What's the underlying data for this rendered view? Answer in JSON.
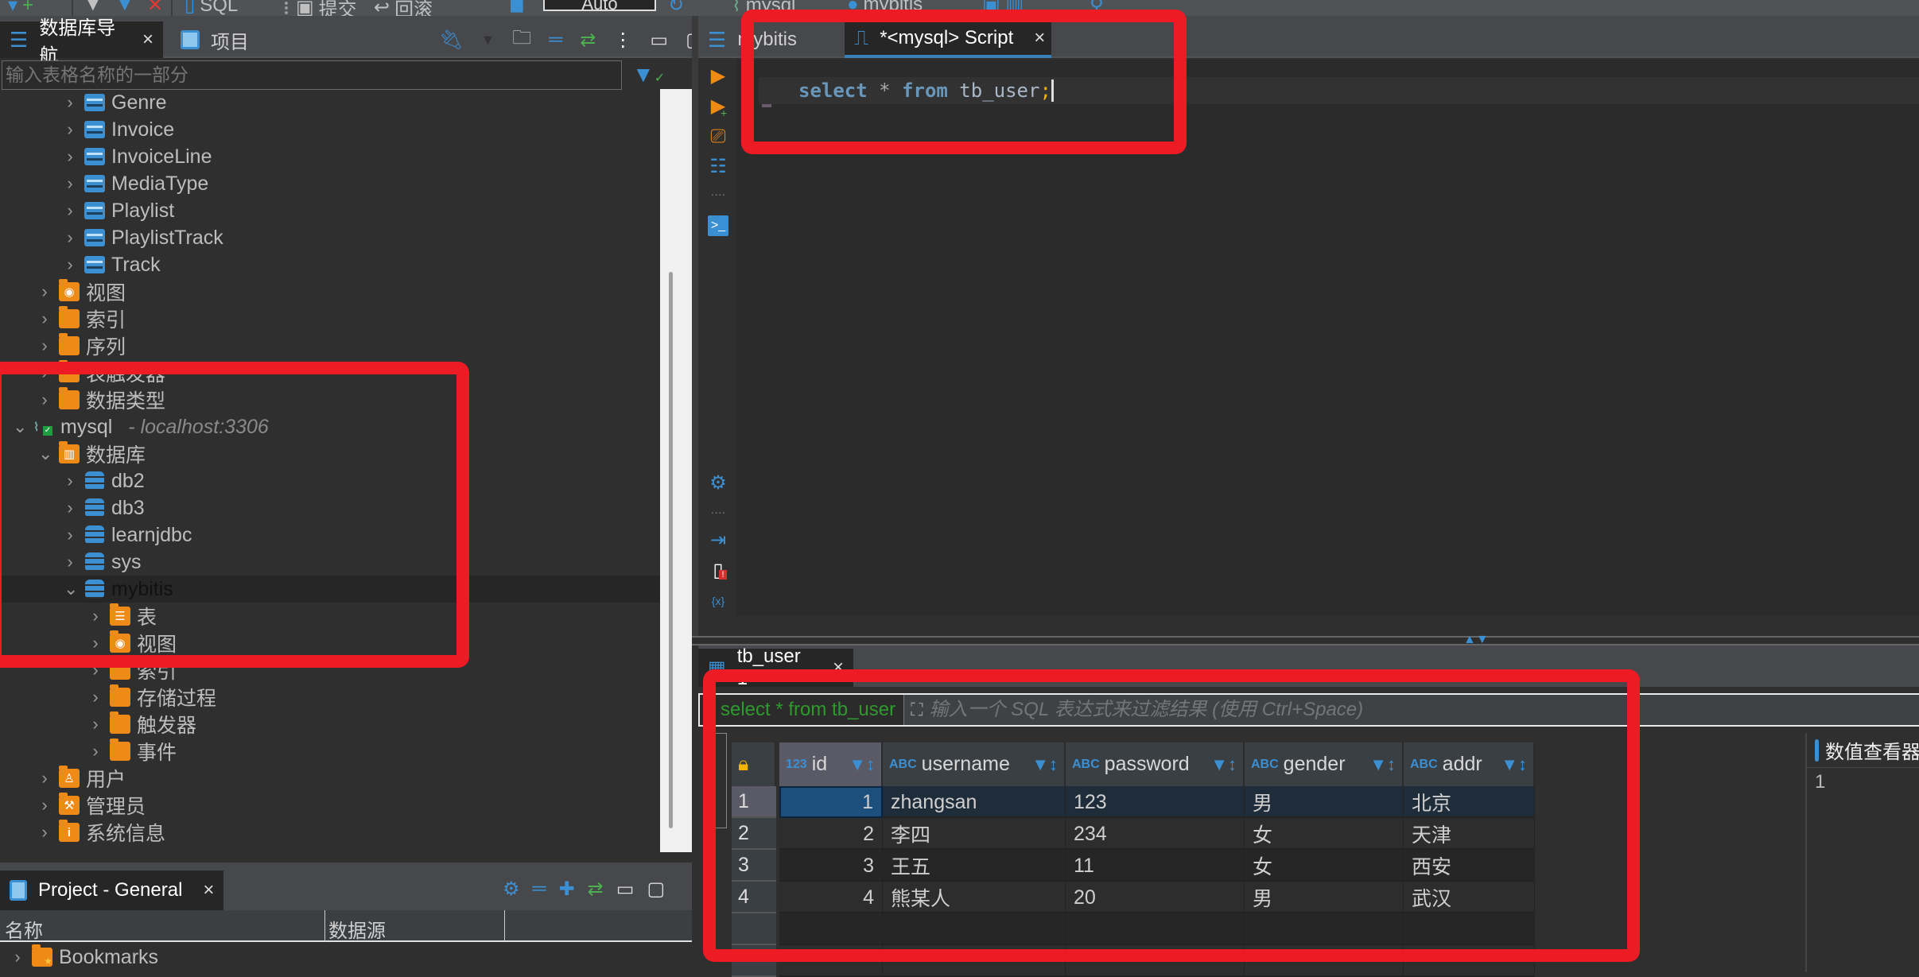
{
  "toolbar": {
    "sql_label": "SQL",
    "commit_label": "提交",
    "rollback_label": "回滚",
    "tx_mode": "Auto",
    "connection": "mysql",
    "database": "mybitis"
  },
  "nav": {
    "tabs": [
      {
        "label": "数据库导航",
        "active": true
      },
      {
        "label": "项目",
        "active": false
      }
    ],
    "filter_placeholder": "输入表格名称的一部分",
    "tree": [
      {
        "label": "Genre",
        "icon": "table-icon",
        "indent": 2
      },
      {
        "label": "Invoice",
        "icon": "table-icon",
        "indent": 2
      },
      {
        "label": "InvoiceLine",
        "icon": "table-icon",
        "indent": 2
      },
      {
        "label": "MediaType",
        "icon": "table-icon",
        "indent": 2
      },
      {
        "label": "Playlist",
        "icon": "table-icon",
        "indent": 2
      },
      {
        "label": "PlaylistTrack",
        "icon": "table-icon",
        "indent": 2
      },
      {
        "label": "Track",
        "icon": "table-icon",
        "indent": 2
      },
      {
        "label": "视图",
        "icon": "view-folder-icon",
        "indent": 1
      },
      {
        "label": "索引",
        "icon": "folder-icon",
        "indent": 1
      },
      {
        "label": "序列",
        "icon": "folder-icon",
        "indent": 1
      },
      {
        "label": "表触发器",
        "icon": "folder-icon",
        "indent": 1
      },
      {
        "label": "数据类型",
        "icon": "folder-icon",
        "indent": 1
      },
      {
        "label": "mysql",
        "sublabel": "- localhost:3306",
        "icon": "mysql-icon",
        "indent": 0,
        "expanded": true
      },
      {
        "label": "数据库",
        "icon": "databases-folder-icon",
        "indent": 1,
        "expanded": true
      },
      {
        "label": "db2",
        "icon": "database-icon",
        "indent": 2
      },
      {
        "label": "db3",
        "icon": "database-icon",
        "indent": 2
      },
      {
        "label": "learnjdbc",
        "icon": "database-icon",
        "indent": 2
      },
      {
        "label": "sys",
        "icon": "database-icon",
        "indent": 2
      },
      {
        "label": "mybitis",
        "icon": "database-icon",
        "indent": 2,
        "expanded": true,
        "selected": true
      },
      {
        "label": "表",
        "icon": "tables-folder-icon",
        "indent": 3
      },
      {
        "label": "视图",
        "icon": "view-folder-icon",
        "indent": 3
      },
      {
        "label": "索引",
        "icon": "folder-icon",
        "indent": 3
      },
      {
        "label": "存储过程",
        "icon": "folder-icon",
        "indent": 3
      },
      {
        "label": "触发器",
        "icon": "folder-icon",
        "indent": 3
      },
      {
        "label": "事件",
        "icon": "folder-icon",
        "indent": 3
      },
      {
        "label": "用户",
        "icon": "users-folder-icon",
        "indent": 1
      },
      {
        "label": "管理员",
        "icon": "admin-folder-icon",
        "indent": 1
      },
      {
        "label": "系统信息",
        "icon": "info-folder-icon",
        "indent": 1
      }
    ]
  },
  "project": {
    "tab": "Project - General",
    "columns": [
      "名称",
      "数据源"
    ],
    "items": [
      "Bookmarks"
    ]
  },
  "editor": {
    "tabs": [
      {
        "label": "mybitis",
        "active": false
      },
      {
        "label": "*<mysql> Script",
        "active": true
      }
    ],
    "code": {
      "kw1": "select",
      "op": " * ",
      "kw2": "from",
      "ident": " tb_user",
      "semi": ";"
    }
  },
  "results": {
    "tab": "tb_user 1",
    "query": "select * from tb_user",
    "filter_placeholder": "输入一个 SQL 表达式来过滤结果 (使用 Ctrl+Space)",
    "columns": [
      {
        "type": "123",
        "name": "id"
      },
      {
        "type": "ABC",
        "name": "username"
      },
      {
        "type": "ABC",
        "name": "password"
      },
      {
        "type": "ABC",
        "name": "gender"
      },
      {
        "type": "ABC",
        "name": "addr"
      }
    ],
    "rows": [
      [
        "1",
        "zhangsan",
        "123",
        "男",
        "北京"
      ],
      [
        "2",
        "李四",
        "234",
        "女",
        "天津"
      ],
      [
        "3",
        "王五",
        "11",
        "女",
        "西安"
      ],
      [
        "4",
        "熊某人",
        "20",
        "男",
        "武汉"
      ]
    ],
    "viewer": {
      "title": "数值查看器",
      "value": "1"
    }
  },
  "colors": {
    "accent": "#3b8fd3",
    "folder": "#f08a16",
    "highlight": "#ed1c24",
    "query_green": "#2e9a2e"
  }
}
